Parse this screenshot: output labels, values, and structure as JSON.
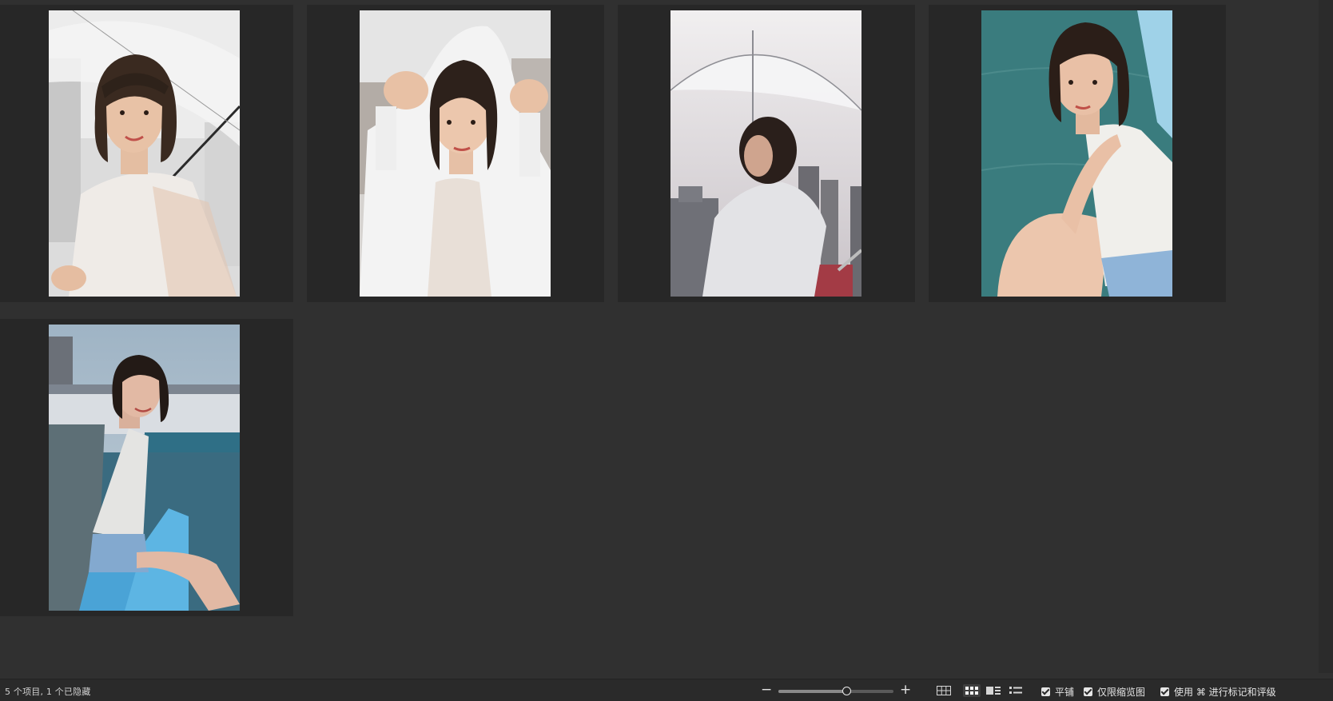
{
  "photos": [
    {
      "name": "photo-1-umbrella-smiling",
      "sky": "#e9e9e9",
      "bg": "#cfcfcf",
      "skin": "#e8c2a6",
      "hair": "#3a2a20",
      "coat": "#eeeae6"
    },
    {
      "name": "photo-2-raincoat-hood",
      "sky": "#dedede",
      "bg": "#bfbbb6",
      "skin": "#ecc7ad",
      "hair": "#2d211b",
      "coat": "#f2f2f2"
    },
    {
      "name": "photo-3-umbrella-skyline",
      "sky": "#d9d6d9",
      "bg": "#7e7e86",
      "skin": "#cfa48e",
      "hair": "#2a1f1b",
      "coat": "#dcdcdf"
    },
    {
      "name": "photo-4-pool-edge",
      "sky": "#3f7f80",
      "bg": "#38777a",
      "skin": "#e9c0a6",
      "hair": "#2b1e18",
      "coat": "#f0efeb"
    },
    {
      "name": "photo-5-poolside-sitting",
      "sky": "#a9bccb",
      "bg": "#3d6c80",
      "skin": "#e2b9a4",
      "hair": "#231a16",
      "coat": "#e3e3e3"
    }
  ],
  "status": {
    "item_count": "5 个项目, 1 个已隐藏"
  },
  "zoom": {
    "minus": "−",
    "plus": "+",
    "level": 0.6
  },
  "options": {
    "tile": "平铺",
    "thumbnails_only": "仅限缩览图",
    "use_cmd_label": "使用 ⌘ 进行标记和评级"
  },
  "colors": {
    "background": "#303030",
    "cell": "#272727",
    "statusbar": "#2a2a2a"
  }
}
